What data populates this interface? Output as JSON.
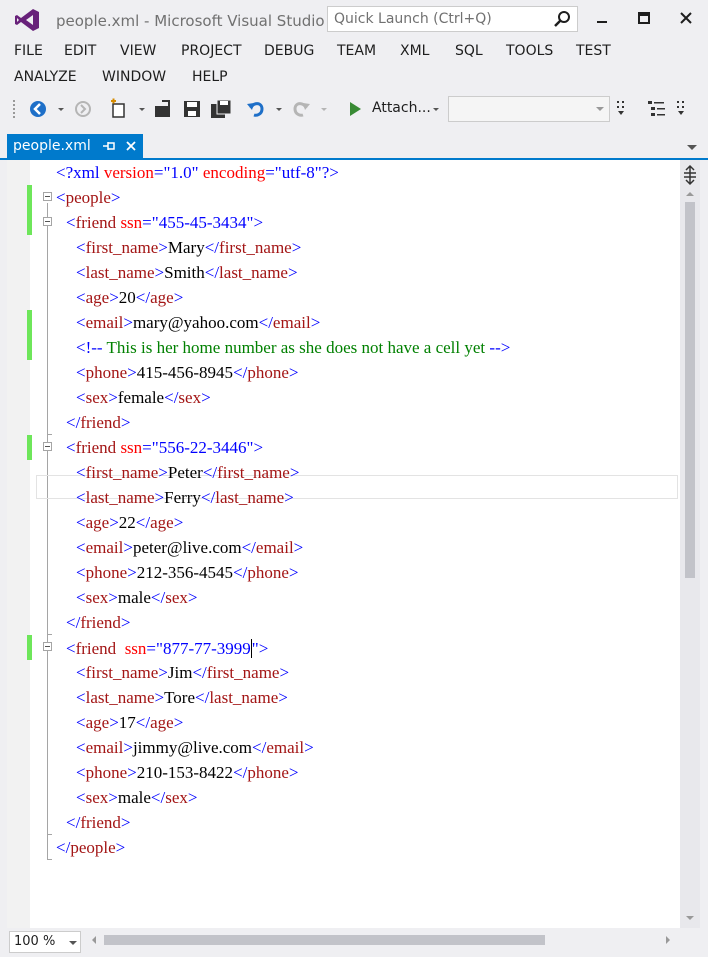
{
  "window": {
    "title": "people.xml - Microsoft Visual Studio",
    "quick_launch_placeholder": "Quick Launch (Ctrl+Q)"
  },
  "menu": [
    "FILE",
    "EDIT",
    "VIEW",
    "PROJECT",
    "DEBUG",
    "TEAM",
    "XML",
    "SQL",
    "TOOLS",
    "TEST",
    "ANALYZE",
    "WINDOW",
    "HELP"
  ],
  "toolbar": {
    "attach_label": "Attach..."
  },
  "tab": {
    "label": "people.xml",
    "pin": "⊣",
    "close": "✕"
  },
  "status": {
    "zoom": "100 %"
  },
  "code": {
    "decl": {
      "open": "<?xml ",
      "version_name": "version",
      "eq1": "=\"",
      "version_val": "1.0",
      "q1": "\" ",
      "enc_name": "encoding",
      "eq2": "=\"",
      "enc_val": "utf-8",
      "close": "\"?>"
    },
    "people_open": "people",
    "people_close": "people",
    "friends": [
      {
        "attr": "ssn",
        "ssn": "455-45-3434",
        "first_name": "Mary",
        "last_name": "Smith",
        "age": "20",
        "email": "mary@yahoo.com",
        "comment": "This is her home number as she does not have a cell yet",
        "phone": "415-456-8945",
        "sex": "female"
      },
      {
        "attr": "ssn",
        "ssn": "556-22-3446",
        "first_name": "Peter",
        "last_name": "Ferry",
        "age": "22",
        "email": "peter@live.com",
        "phone": "212-356-4545",
        "sex": "male"
      },
      {
        "attr": "ssn",
        "ssn": "877-77-3999",
        "first_name": "Jim",
        "last_name": "Tore",
        "age": "17",
        "email": "jimmy@live.com",
        "phone": "210-153-8422",
        "sex": "male"
      }
    ]
  }
}
